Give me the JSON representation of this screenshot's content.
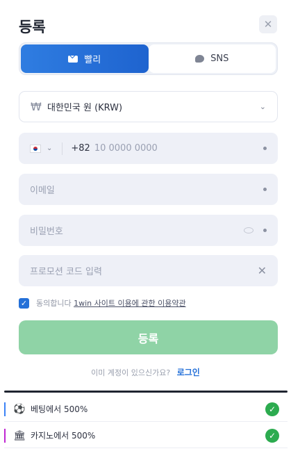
{
  "header": {
    "title": "등록",
    "close_icon": "✕"
  },
  "tabs": [
    {
      "label": "빨리",
      "icon": "mail-icon",
      "active": true
    },
    {
      "label": "SNS",
      "icon": "chat-icon",
      "active": false
    }
  ],
  "form": {
    "currency": {
      "symbol": "₩",
      "value": "대한민국 원 (KRW)",
      "chevron": "⌄"
    },
    "phone": {
      "flag": "kr-flag",
      "code": "+82",
      "placeholder": "10 0000 0000"
    },
    "email": {
      "placeholder": "이메일"
    },
    "password": {
      "placeholder": "비밀번호"
    },
    "promo": {
      "placeholder": "프로모션 코드 입력",
      "clear_icon": "✕"
    }
  },
  "agreement": {
    "checked": true,
    "check_glyph": "✓",
    "prefix": "동의합니다",
    "link": "1win 사이트 이용에 관한 이용약관"
  },
  "submit": {
    "label": "등록"
  },
  "login": {
    "prompt": "이미 계정이 있으신가요?",
    "link": "로그인"
  },
  "promos": [
    {
      "emoji": "⚽",
      "label": "베팅에서 500%",
      "accent": "#3b82f6",
      "check_glyph": "✓"
    },
    {
      "emoji": "🏛",
      "label": "카지노에서 500%",
      "accent": "#c026d3",
      "check_glyph": "✓"
    }
  ],
  "colors": {
    "primary": "#2470d8",
    "submit": "#8fd3a6",
    "success": "#2cab4f"
  }
}
